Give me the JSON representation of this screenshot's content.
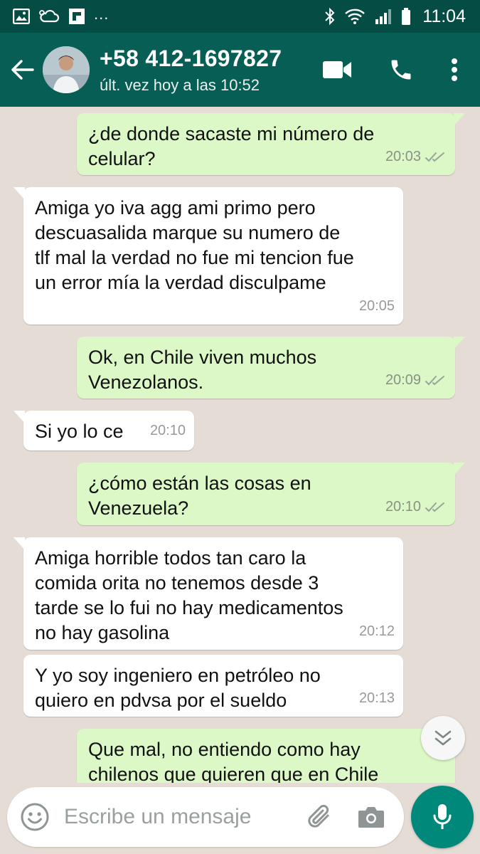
{
  "status_bar": {
    "time": "11:04",
    "notification_icons": [
      "image-icon",
      "cloud-icon",
      "flipboard-icon"
    ],
    "more_notifications": "...",
    "system_icons": [
      "bluetooth-icon",
      "wifi-icon",
      "signal-icon",
      "battery-icon"
    ]
  },
  "header": {
    "contact_name": "+58 412-1697827",
    "last_seen": "últ. vez hoy a las 10:52",
    "colors": {
      "header_bg": "#075e54",
      "status_bg": "#054d44"
    }
  },
  "messages": [
    {
      "direction": "out",
      "text": "¿de donde sacaste mi número de\ncelular?",
      "time": "20:03",
      "read": true
    },
    {
      "direction": "in",
      "text": "Amiga yo iva agg ami primo pero\ndescuasalida marque su numero de\ntlf mal la verdad no fue mi tencion fue\nun error mía la verdad disculpame",
      "time": "20:05"
    },
    {
      "direction": "out",
      "text": "Ok, en Chile viven muchos\nVenezolanos.",
      "time": "20:09",
      "read": true
    },
    {
      "direction": "in",
      "text": "Si yo lo ce",
      "time": "20:10"
    },
    {
      "direction": "out",
      "text": "¿cómo están las cosas en\nVenezuela?",
      "time": "20:10",
      "read": true
    },
    {
      "direction": "in",
      "text": "Amiga horrible todos tan caro la\ncomida orita no tenemos desde 3\ntarde se lo fui no hay medicamentos\nno hay gasolina",
      "time": "20:12"
    },
    {
      "direction": "in",
      "text": "Y yo soy ingeniero en petróleo no\nquiero en pdvsa por el sueldo",
      "time": "20:13"
    },
    {
      "direction": "out",
      "text": "Que mal, no entiendo como hay\nchilenos que quieren que en Chile",
      "time": "",
      "read": false
    }
  ],
  "composer": {
    "placeholder": "Escribe un mensaje"
  },
  "colors": {
    "chat_bg": "#e5ddd5",
    "outgoing_bubble": "#dcf8c6",
    "incoming_bubble": "#ffffff",
    "mic_button": "#00897b",
    "read_ticks": "#9aa49a"
  }
}
